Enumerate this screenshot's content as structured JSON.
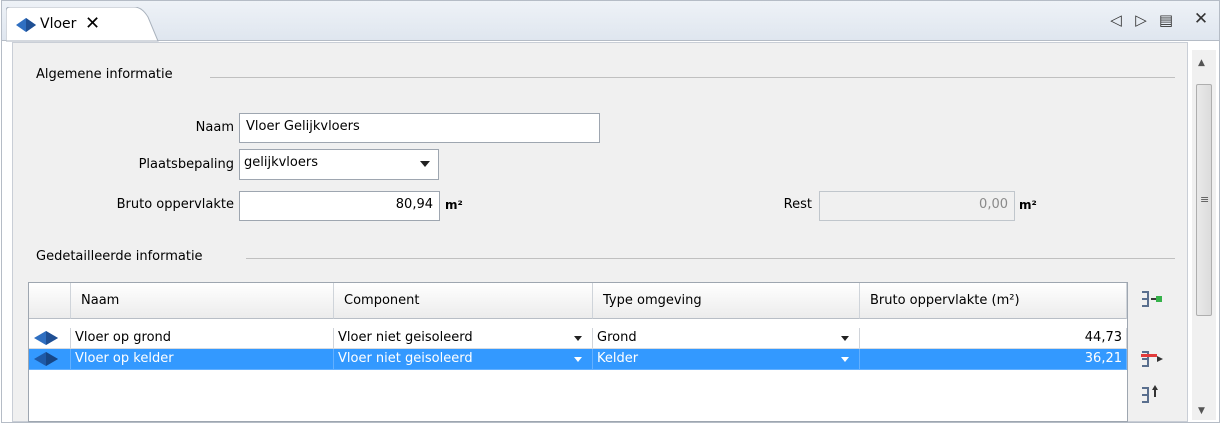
{
  "tab": {
    "label": "Vloer",
    "close": "✕",
    "icon": "floor-slab-icon"
  },
  "toolbar": {
    "prev": "◁",
    "next": "▷",
    "menu": "▤",
    "close": "✕"
  },
  "general": {
    "title": "Algemene informatie",
    "naam_label": "Naam",
    "naam_value": "Vloer Gelijkvloers",
    "plaats_label": "Plaatsbepaling",
    "plaats_value": "gelijkvloers",
    "opp_label": "Bruto oppervlakte",
    "opp_value": "80,94",
    "unit": "m²",
    "rest_label": "Rest",
    "rest_value": "0,00"
  },
  "detail": {
    "title": "Gedetailleerde informatie",
    "columns": [
      "Naam",
      "Component",
      "Type omgeving",
      "Bruto oppervlakte (m²)"
    ],
    "rows": [
      {
        "naam": "Vloer op grond",
        "component": "Vloer niet geisoleerd",
        "omgeving": "Grond",
        "opp": "44,73",
        "selected": false
      },
      {
        "naam": "Vloer op kelder",
        "component": "Vloer niet geisoleerd",
        "omgeving": "Kelder",
        "opp": "36,21",
        "selected": true
      }
    ]
  },
  "colors": {
    "selection": "#3399ff",
    "icon_blue": "#2f6fc1"
  }
}
